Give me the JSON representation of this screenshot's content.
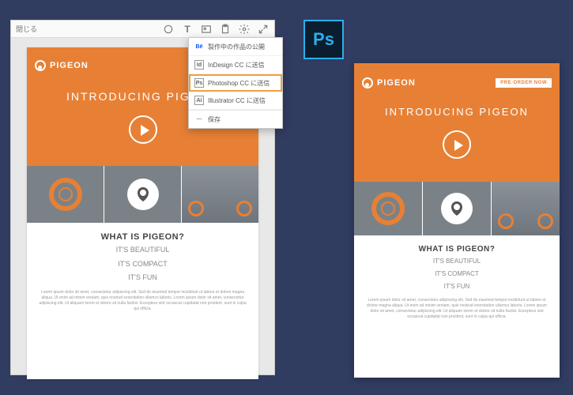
{
  "editor": {
    "close_label": "閉じる",
    "tool_icons": [
      "draw",
      "text",
      "image",
      "paste",
      "settings",
      "expand"
    ]
  },
  "dropdown": {
    "items": [
      {
        "icon": "Bē",
        "label": "製作中の作品の公開",
        "icon_class": "be"
      },
      {
        "icon": "Id",
        "label": "InDesign CC に送信",
        "icon_class": ""
      },
      {
        "icon": "Ps",
        "label": "Photoshop CC に送信",
        "icon_class": "",
        "selected": true
      },
      {
        "icon": "Ai",
        "label": "Illustrator CC に送信",
        "icon_class": ""
      },
      {
        "icon": "⋯",
        "label": "保存",
        "icon_class": "",
        "sep_before": true
      }
    ]
  },
  "mockup": {
    "brand": "PIGEON",
    "hero_title": "INTRODUCING PIGEON",
    "preorder_label": "PRE-ORDER NOW",
    "section_title": "WHAT IS PIGEON?",
    "taglines": [
      "IT'S BEAUTIFUL",
      "IT'S COMPACT",
      "IT'S FUN"
    ],
    "lorem": "Lorem ipsum dolor sit amet, consectetur adipiscing elit. Sed do eiusmod tempor incididunt ut labore et dolore magna aliqua. Ut enim ad minim veniam, quis nostrud exercitation ullamco laboris. Lorem ipsum dolor sit amet, consectetur adipiscing elit. Ut aliquam lorem et dolore sit nulla facilisi. Excepteur sint occaecat cupidatat non proident, sunt in culpa qui officia."
  },
  "app_icon": {
    "label": "Ps",
    "name": "Photoshop CC"
  }
}
